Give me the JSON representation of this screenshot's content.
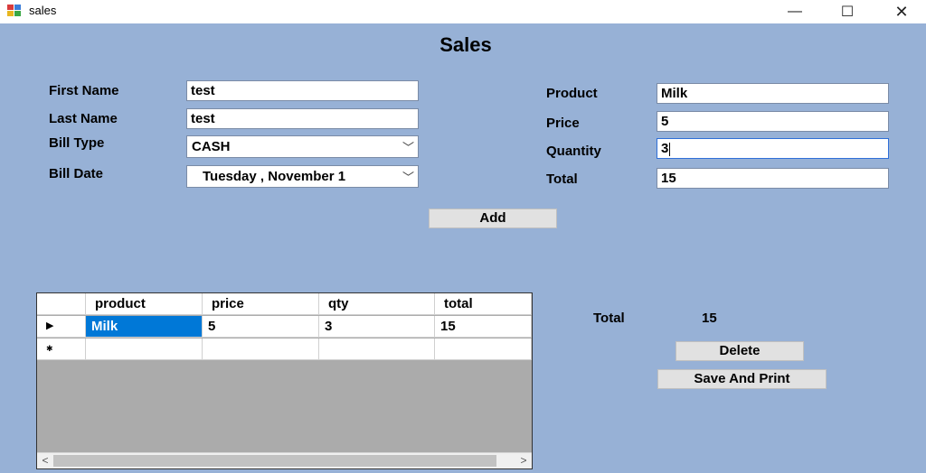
{
  "window": {
    "title": "sales",
    "minimize_glyph": "—",
    "maximize_glyph": "☐",
    "close_glyph": "✕"
  },
  "form": {
    "title": "Sales",
    "first_name_label": "First Name",
    "first_name_value": "test",
    "last_name_label": "Last Name",
    "last_name_value": "test",
    "bill_type_label": "Bill Type",
    "bill_type_value": "CASH",
    "bill_date_label": "Bill Date",
    "bill_date_value": "Tuesday   , November 1",
    "product_label": "Product",
    "product_value": "Milk",
    "price_label": "Price",
    "price_value": "5",
    "quantity_label": "Quantity",
    "quantity_value": "3",
    "total_label": "Total",
    "total_value": "15",
    "add_label": "Add"
  },
  "grid": {
    "columns": [
      "product",
      "price",
      "qty",
      "total"
    ],
    "rows": [
      {
        "product": "Milk",
        "price": "5",
        "qty": "3",
        "total": "15"
      }
    ],
    "current_row_glyph": "▶",
    "new_row_glyph": "✱",
    "scroll_left_glyph": "<",
    "scroll_right_glyph": ">"
  },
  "summary": {
    "total_label": "Total",
    "total_value": "15",
    "delete_label": "Delete",
    "save_print_label": "Save And Print"
  },
  "icons": {
    "app_icon": "sales-app-icon",
    "dropdown_icon": "chevron-down-icon"
  }
}
